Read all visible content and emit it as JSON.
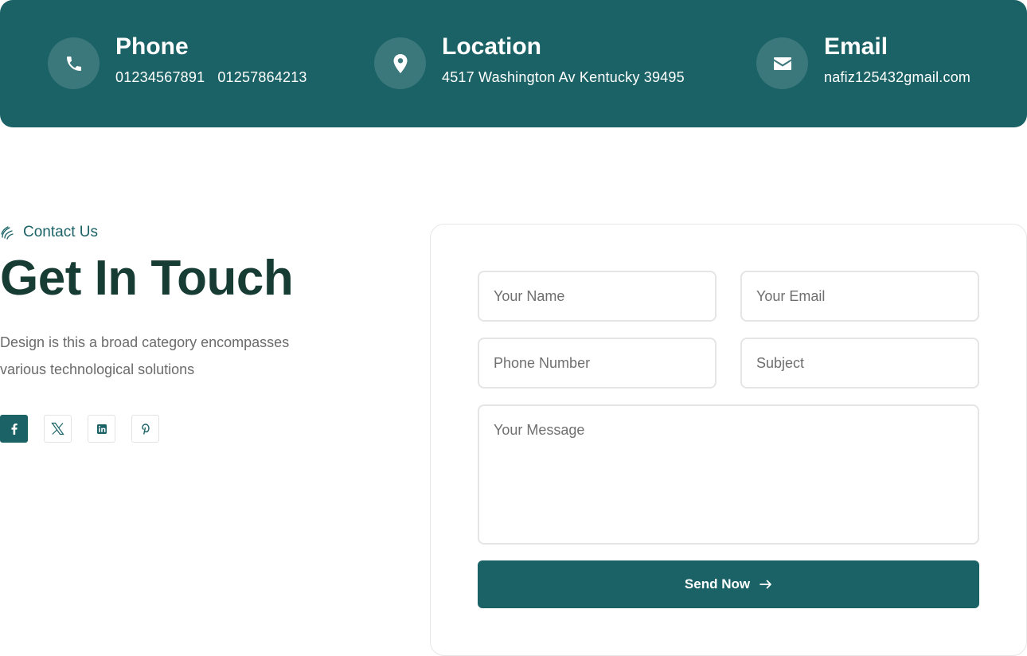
{
  "contact_info": [
    {
      "title": "Phone",
      "values": [
        "01234567891",
        "01257864213"
      ],
      "icon": "phone-icon"
    },
    {
      "title": "Location",
      "values": [
        "4517 Washington Av Kentucky 39495"
      ],
      "icon": "map-pin-icon"
    },
    {
      "title": "Email",
      "values": [
        "nafiz125432gmail.com"
      ],
      "icon": "envelope-icon"
    }
  ],
  "section": {
    "eyebrow": "Contact Us",
    "heading": "Get In Touch",
    "description": "Design is this a broad category encompasses various technological solutions"
  },
  "socials": [
    {
      "name": "facebook",
      "icon": "facebook-icon",
      "active": true
    },
    {
      "name": "x",
      "icon": "x-icon",
      "active": false
    },
    {
      "name": "linkedin",
      "icon": "linkedin-icon",
      "active": false
    },
    {
      "name": "pinterest",
      "icon": "pinterest-icon",
      "active": false
    }
  ],
  "form": {
    "name_placeholder": "Your Name",
    "email_placeholder": "Your Email",
    "phone_placeholder": "Phone Number",
    "subject_placeholder": "Subject",
    "message_placeholder": "Your Message",
    "submit_label": "Send Now"
  },
  "colors": {
    "primary": "#1b6266",
    "heading": "#173c34",
    "muted_text": "#6b6b6b"
  }
}
